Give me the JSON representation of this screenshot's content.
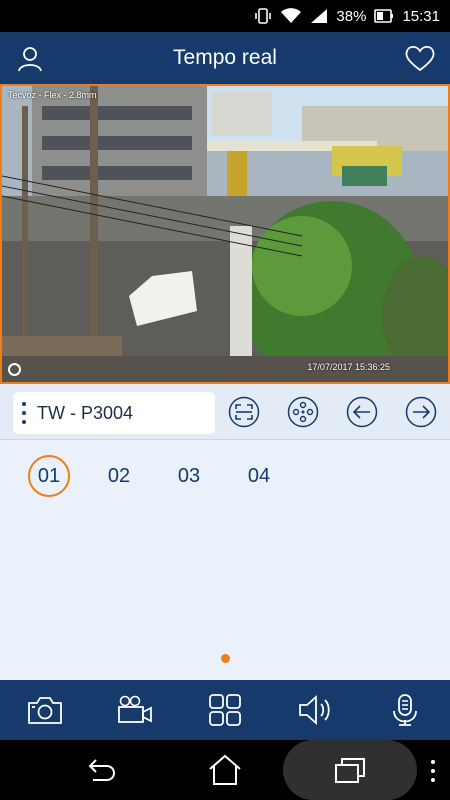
{
  "status_bar": {
    "battery_percent": "38%",
    "time": "15:31",
    "icons": [
      "vibrate-icon",
      "wifi-icon",
      "signal-icon",
      "battery-icon"
    ]
  },
  "header": {
    "title": "Tempo real",
    "left_icon": "user-icon",
    "right_icon": "heart-icon"
  },
  "video": {
    "camera_label": "Tecvoz - Flex - 2.8mm",
    "timestamp": "17/07/2017 15:36:25"
  },
  "toolbar": {
    "device_name": "TW - P3004",
    "buttons": [
      "fullscreen-icon",
      "ptz-icon",
      "previous-icon",
      "next-icon"
    ]
  },
  "channels": [
    "01",
    "02",
    "03",
    "04"
  ],
  "active_channel": "01",
  "action_bar": {
    "buttons": [
      "snapshot-camera-icon",
      "record-video-icon",
      "multiview-grid-icon",
      "audio-speaker-icon",
      "microphone-icon"
    ]
  },
  "colors": {
    "primary": "#153a6b",
    "accent": "#f07d1c",
    "background": "#eaf1fa"
  }
}
